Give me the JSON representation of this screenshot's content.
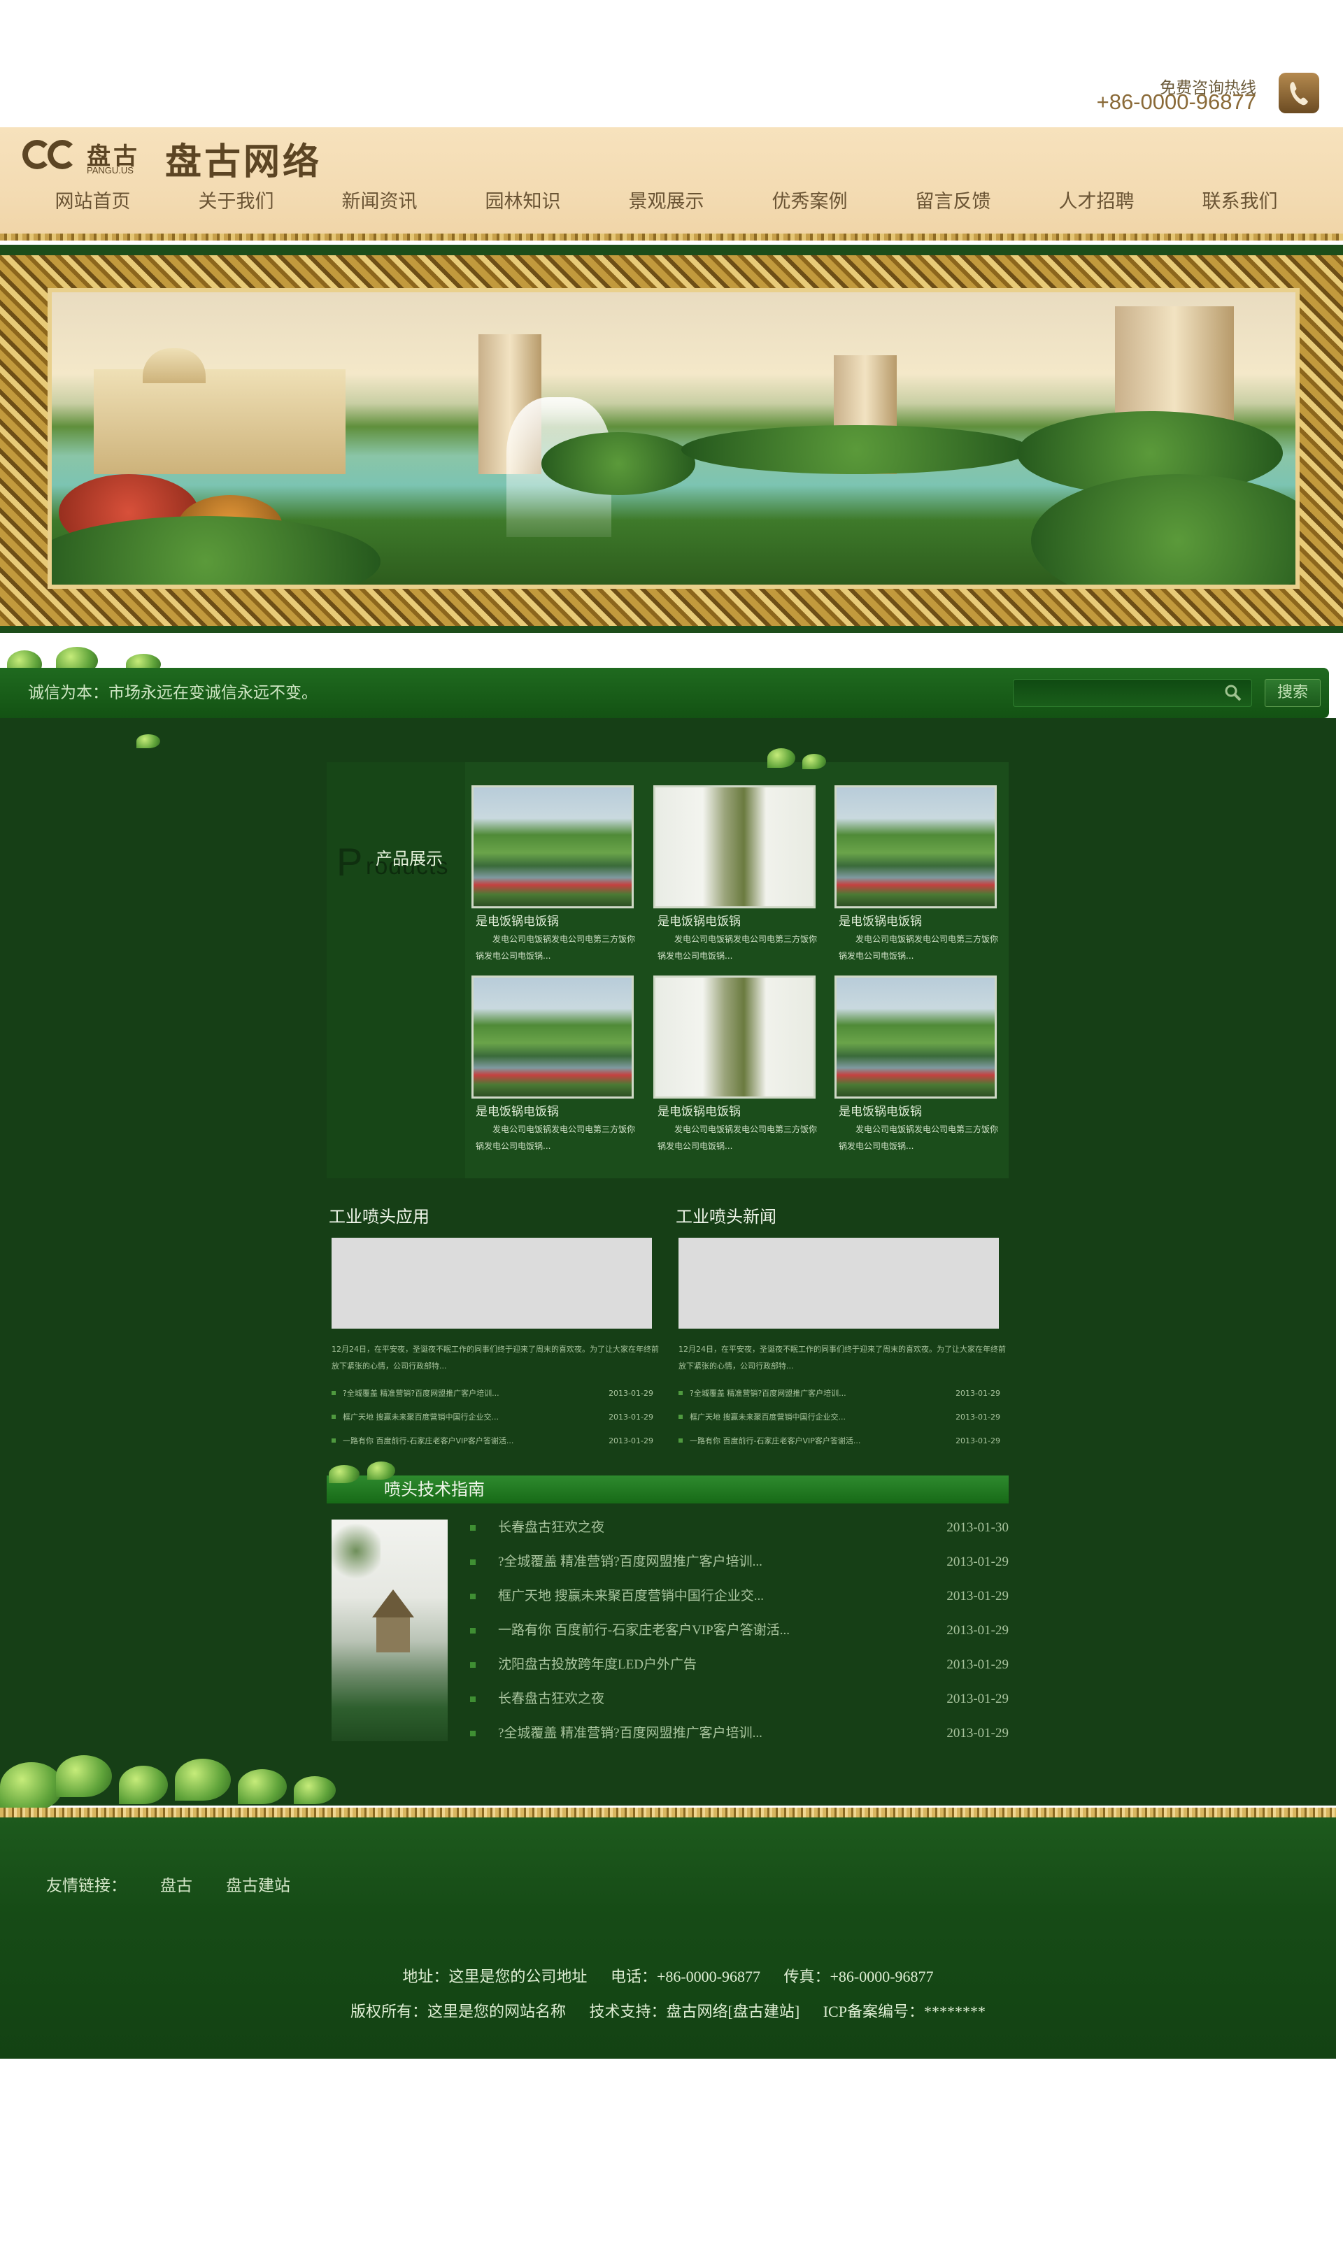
{
  "hotline": {
    "label": "免费咨询热线",
    "number": "+86-0000-96877"
  },
  "header": {
    "logo_cn": "盘古",
    "logo_en": "PANGU.US",
    "site_name": "盘古网络",
    "nav": [
      "网站首页",
      "关于我们",
      "新闻资讯",
      "园林知识",
      "景观展示",
      "优秀案例",
      "留言反馈",
      "人才招聘",
      "联系我们"
    ]
  },
  "slogan": "诚信为本：市场永远在变诚信永远不变。",
  "search": {
    "value": "",
    "button": "搜索"
  },
  "products": {
    "title_cn": "产品展示",
    "title_en_first": "P",
    "title_en_rest": "roducts",
    "items": [
      {
        "name": "是电饭锅电饭锅",
        "desc": "发电公司电饭锅发电公司电第三方饭你锅发电公司电饭锅...",
        "image": "lake"
      },
      {
        "name": "是电饭锅电饭锅",
        "desc": "发电公司电饭锅发电公司电第三方饭你锅发电公司电饭锅...",
        "image": "garden"
      },
      {
        "name": "是电饭锅电饭锅",
        "desc": "发电公司电饭锅发电公司电第三方饭你锅发电公司电饭锅...",
        "image": "lake"
      },
      {
        "name": "是电饭锅电饭锅",
        "desc": "发电公司电饭锅发电公司电第三方饭你锅发电公司电饭锅...",
        "image": "lake"
      },
      {
        "name": "是电饭锅电饭锅",
        "desc": "发电公司电饭锅发电公司电第三方饭你锅发电公司电饭锅...",
        "image": "garden"
      },
      {
        "name": "是电饭锅电饭锅",
        "desc": "发电公司电饭锅发电公司电第三方饭你锅发电公司电饭锅...",
        "image": "lake"
      }
    ]
  },
  "application": {
    "title": "工业喷头应用",
    "intro": "12月24日，在平安夜，圣诞夜不眠工作的同事们终于迎来了周末的喜欢夜。为了让大家在年终前放下紧张的心情，公司行政部特...",
    "news": [
      {
        "title": "?全城覆盖 精准营销?百度网盟推广客户培训...",
        "date": "2013-01-29"
      },
      {
        "title": "框广天地 搜赢未来聚百度营销中国行企业交...",
        "date": "2013-01-29"
      },
      {
        "title": "一路有你 百度前行-石家庄老客户VIP客户答谢活...",
        "date": "2013-01-29"
      }
    ]
  },
  "news_col": {
    "title": "工业喷头新闻",
    "intro": "12月24日，在平安夜，圣诞夜不眠工作的同事们终于迎来了周末的喜欢夜。为了让大家在年终前放下紧张的心情，公司行政部特...",
    "news": [
      {
        "title": "?全城覆盖 精准营销?百度网盟推广客户培训...",
        "date": "2013-01-29"
      },
      {
        "title": "框广天地 搜赢未来聚百度营销中国行企业交...",
        "date": "2013-01-29"
      },
      {
        "title": "一路有你 百度前行-石家庄老客户VIP客户答谢活...",
        "date": "2013-01-29"
      }
    ]
  },
  "guide": {
    "title": "喷头技术指南",
    "items": [
      {
        "title": "长春盘古狂欢之夜",
        "date": "2013-01-30"
      },
      {
        "title": "?全城覆盖 精准营销?百度网盟推广客户培训...",
        "date": "2013-01-29"
      },
      {
        "title": "框广天地 搜赢未来聚百度营销中国行企业交...",
        "date": "2013-01-29"
      },
      {
        "title": "一路有你 百度前行-石家庄老客户VIP客户答谢活...",
        "date": "2013-01-29"
      },
      {
        "title": "沈阳盘古投放跨年度LED户外广告",
        "date": "2013-01-29"
      },
      {
        "title": "长春盘古狂欢之夜",
        "date": "2013-01-29"
      },
      {
        "title": "?全城覆盖 精准营销?百度网盟推广客户培训...",
        "date": "2013-01-29"
      }
    ]
  },
  "footer": {
    "links_label": "友情链接：",
    "links": [
      "盘古",
      "盘古建站"
    ],
    "address": "地址：这里是您的公司地址",
    "phone": "电话：+86-0000-96877",
    "fax": "传真：+86-0000-96877",
    "copyright": "版权所有：这里是您的网站名称",
    "support": "技术支持：盘古网络[盘古建站]",
    "icp": "ICP备案编号：********"
  },
  "colors": {
    "dark_green": "#163f16",
    "header_beige": "#f3dbb2",
    "gold": "#c29a3d"
  }
}
